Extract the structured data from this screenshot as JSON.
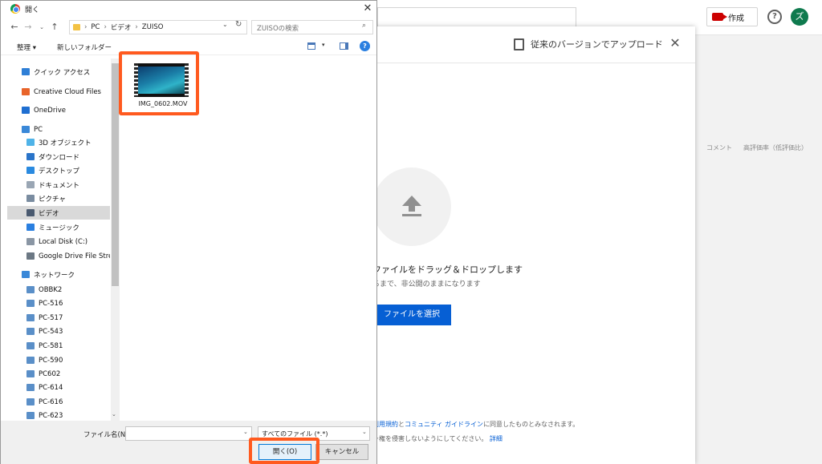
{
  "background": {
    "create_label": "作成",
    "help_label": "?",
    "avatar_letter": "ズ",
    "table_headers": [
      "コメント",
      "高評価率（低評価比）"
    ]
  },
  "upload": {
    "legacy_label": "従来のバージョンでアップロード",
    "close_label": "✕",
    "drop_text": "ファイルをドラッグ＆ドロップします",
    "private_text": "るまで、非公開のままになります",
    "select_button": "ファイルを選択",
    "terms_line1_prefix": "",
    "terms_line1_link1": "利用規約",
    "terms_line1_mid": "と",
    "terms_line1_link2": "コミュニティ ガイドライン",
    "terms_line1_suffix": "に同意したものとみなされます。",
    "terms_line2_prefix": "ー権を侵害しないようにしてください。",
    "terms_line2_link": "詳細"
  },
  "file_dialog": {
    "title": "開く",
    "close_label": "✕",
    "breadcrumb": [
      "PC",
      "ビデオ",
      "ZUISO"
    ],
    "search_placeholder": "ZUISOの検索",
    "organize_label": "整理 ▾",
    "new_folder_label": "新しいフォルダー",
    "nav_items": [
      {
        "label": "クイック アクセス",
        "icon": "star-icon",
        "color": "#2f7fd6",
        "indent": 0
      },
      {
        "label": "Creative Cloud Files",
        "icon": "creative-cloud-icon",
        "color": "#e8642a",
        "indent": 0
      },
      {
        "label": "OneDrive",
        "icon": "cloud-icon",
        "color": "#1f6fd1",
        "indent": 0
      },
      {
        "label": "PC",
        "icon": "pc-icon",
        "color": "#3a88d8",
        "indent": 0
      },
      {
        "label": "3D オブジェクト",
        "icon": "cube-icon",
        "color": "#4fb3e8",
        "indent": 1
      },
      {
        "label": "ダウンロード",
        "icon": "download-icon",
        "color": "#2a74c9",
        "indent": 1
      },
      {
        "label": "デスクトップ",
        "icon": "desktop-icon",
        "color": "#2a8ae0",
        "indent": 1
      },
      {
        "label": "ドキュメント",
        "icon": "document-icon",
        "color": "#9aa6b4",
        "indent": 1
      },
      {
        "label": "ピクチャ",
        "icon": "picture-icon",
        "color": "#7a8ca0",
        "indent": 1
      },
      {
        "label": "ビデオ",
        "icon": "video-icon",
        "color": "#4a5a70",
        "indent": 1,
        "selected": true
      },
      {
        "label": "ミュージック",
        "icon": "music-icon",
        "color": "#2a7fe0",
        "indent": 1
      },
      {
        "label": "Local Disk (C:)",
        "icon": "disk-icon",
        "color": "#8a96a4",
        "indent": 1
      },
      {
        "label": "Google Drive File Stream",
        "icon": "drive-icon",
        "color": "#6c7884",
        "indent": 1
      },
      {
        "label": "ネットワーク",
        "icon": "network-icon",
        "color": "#3a88d8",
        "indent": 0
      },
      {
        "label": "OBBK2",
        "icon": "computer-icon",
        "color": "#5a8fc8",
        "indent": 1
      },
      {
        "label": "PC-516",
        "icon": "computer-icon",
        "color": "#5a8fc8",
        "indent": 1
      },
      {
        "label": "PC-517",
        "icon": "computer-icon",
        "color": "#5a8fc8",
        "indent": 1
      },
      {
        "label": "PC-543",
        "icon": "computer-icon",
        "color": "#5a8fc8",
        "indent": 1
      },
      {
        "label": "PC-581",
        "icon": "computer-icon",
        "color": "#5a8fc8",
        "indent": 1
      },
      {
        "label": "PC-590",
        "icon": "computer-icon",
        "color": "#5a8fc8",
        "indent": 1
      },
      {
        "label": "PC602",
        "icon": "computer-icon",
        "color": "#5a8fc8",
        "indent": 1
      },
      {
        "label": "PC-614",
        "icon": "computer-icon",
        "color": "#5a8fc8",
        "indent": 1
      },
      {
        "label": "PC-616",
        "icon": "computer-icon",
        "color": "#5a8fc8",
        "indent": 1
      },
      {
        "label": "PC-623",
        "icon": "computer-icon",
        "color": "#5a8fc8",
        "indent": 1
      }
    ],
    "file": {
      "name": "IMG_0602.MOV",
      "icon": "video-file-icon"
    },
    "filename_label": "ファイル名(N):",
    "filename_value": "",
    "file_type": "すべてのファイル (*.*)",
    "open_button": "開く(O)",
    "cancel_button": "キャンセル",
    "highlight_color": "#ff5a1f"
  }
}
